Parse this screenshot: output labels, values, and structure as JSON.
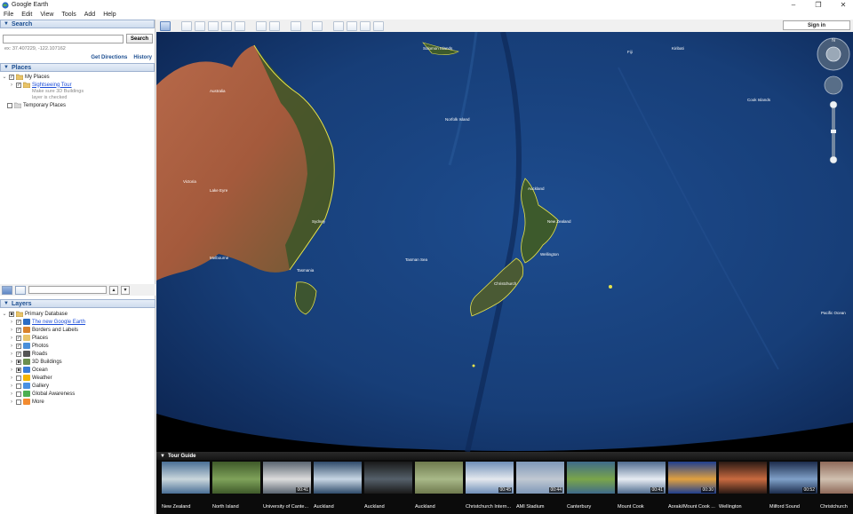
{
  "window": {
    "title": "Google Earth",
    "minimize": "–",
    "restore": "❐",
    "close": "✕"
  },
  "menu": [
    "File",
    "Edit",
    "View",
    "Tools",
    "Add",
    "Help"
  ],
  "search": {
    "header": "Search",
    "placeholder": "",
    "button": "Search",
    "example": "ex: 37.407229, -122.107162",
    "get_directions": "Get Directions",
    "history": "History"
  },
  "places": {
    "header": "Places",
    "my_places": "My Places",
    "sightseeing": "Sightseeing Tour",
    "note_line1": "Make sure 3D Buildings",
    "note_line2": "layer is checked",
    "temporary": "Temporary Places"
  },
  "layers": {
    "header": "Layers",
    "primary": "Primary Database",
    "items": [
      {
        "label": "The new Google Earth",
        "link": true,
        "checked": true
      },
      {
        "label": "Borders and Labels",
        "link": false,
        "checked": true
      },
      {
        "label": "Places",
        "link": false,
        "checked": true
      },
      {
        "label": "Photos",
        "link": false,
        "checked": true
      },
      {
        "label": "Roads",
        "link": false,
        "checked": true
      },
      {
        "label": "3D Buildings",
        "link": false,
        "checked": "partial"
      },
      {
        "label": "Ocean",
        "link": false,
        "checked": "partial"
      },
      {
        "label": "Weather",
        "link": false,
        "checked": false
      },
      {
        "label": "Gallery",
        "link": false,
        "checked": false
      },
      {
        "label": "Global Awareness",
        "link": false,
        "checked": false
      },
      {
        "label": "More",
        "link": false,
        "checked": false
      }
    ]
  },
  "toolbar": {
    "sign_in": "Sign in"
  },
  "map_labels": {
    "australia": "Australia",
    "nz": "New Zealand",
    "solomon": "Solomon Islands",
    "norfolk": "Norfolk Island",
    "kiribati": "Kiribati",
    "fiji": "Fiji",
    "tasman": "Tasman Sea",
    "lake_eyre": "Lake Eyre",
    "victoria": "Victoria",
    "sydney": "Sydney",
    "melbourne": "Melbourne",
    "tasmania": "Tasmania",
    "auckland": "Auckland",
    "wellington": "Wellington",
    "christchurch": "Christchurch",
    "cook_islands": "Cook Islands",
    "pacific": "Pacific Ocean"
  },
  "tour_guide": {
    "header": "Tour Guide",
    "items": [
      {
        "label": "New Zealand",
        "duration": ""
      },
      {
        "label": "North Island",
        "duration": ""
      },
      {
        "label": "University of Cante...",
        "duration": "00:41"
      },
      {
        "label": "Auckland",
        "duration": ""
      },
      {
        "label": "Auckland",
        "duration": ""
      },
      {
        "label": "Auckland",
        "duration": ""
      },
      {
        "label": "Christchurch Intern...",
        "duration": "00:45"
      },
      {
        "label": "AMI Stadium",
        "duration": "00:44"
      },
      {
        "label": "Canterbury",
        "duration": ""
      },
      {
        "label": "Mount Cook",
        "duration": "00:41"
      },
      {
        "label": "Aoraki/Mount Cook ...",
        "duration": "00:30"
      },
      {
        "label": "Wellington",
        "duration": ""
      },
      {
        "label": "Milford Sound",
        "duration": "00:52"
      },
      {
        "label": "Christchurch",
        "duration": ""
      }
    ]
  },
  "colors": {
    "accent": "#1d4f91",
    "ocean": "#173d7a",
    "land": "#3d4f2c",
    "desert": "#b76a48"
  },
  "icons": [
    "google-earth-icon",
    "folder-icon",
    "globe-icon",
    "database-icon",
    "navigation-compass-icon",
    "zoom-slider-icon"
  ]
}
